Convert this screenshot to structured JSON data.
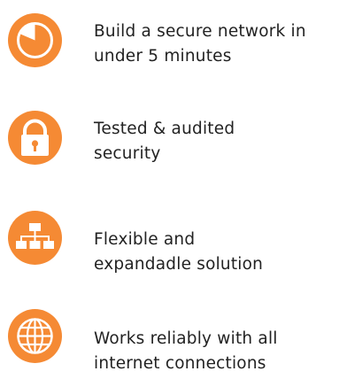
{
  "features": [
    {
      "icon": "clock-icon",
      "line1": "Build a secure network in",
      "line2": "under 5 minutes"
    },
    {
      "icon": "lock-icon",
      "line1": "Tested & audited",
      "line2": "security"
    },
    {
      "icon": "network-tree-icon",
      "line1": "Flexible and",
      "line2": "expandadle solution"
    },
    {
      "icon": "globe-icon",
      "line1": "Works reliably with all",
      "line2": "internet connections"
    }
  ],
  "colors": {
    "accent": "#f58a34",
    "text": "#222222",
    "background": "#ffffff"
  }
}
